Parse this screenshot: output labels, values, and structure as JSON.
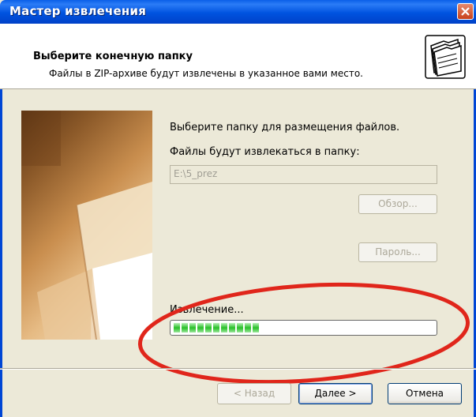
{
  "window": {
    "title": "Мастер извлечения"
  },
  "header": {
    "title": "Выберите конечную папку",
    "subtitle": "Файлы в ZIP-архиве будут извлечены в указанное вами место."
  },
  "main": {
    "instruction": "Выберите папку для размещения файлов.",
    "folder_label": "Файлы будут извлекаться в папку:",
    "folder_value": "E:\\5_prez",
    "browse_label": "Обзор...",
    "password_label": "Пароль...",
    "extract_label": "Извлечение...",
    "progress": {
      "segments": 11,
      "color": "#28C028"
    }
  },
  "footer": {
    "back_label": "< Назад",
    "next_label": "Далее >",
    "cancel_label": "Отмена"
  },
  "colors": {
    "title_bar": "#0053E0",
    "annotation": "#E0261B",
    "dialog_bg": "#ECE9D8"
  }
}
